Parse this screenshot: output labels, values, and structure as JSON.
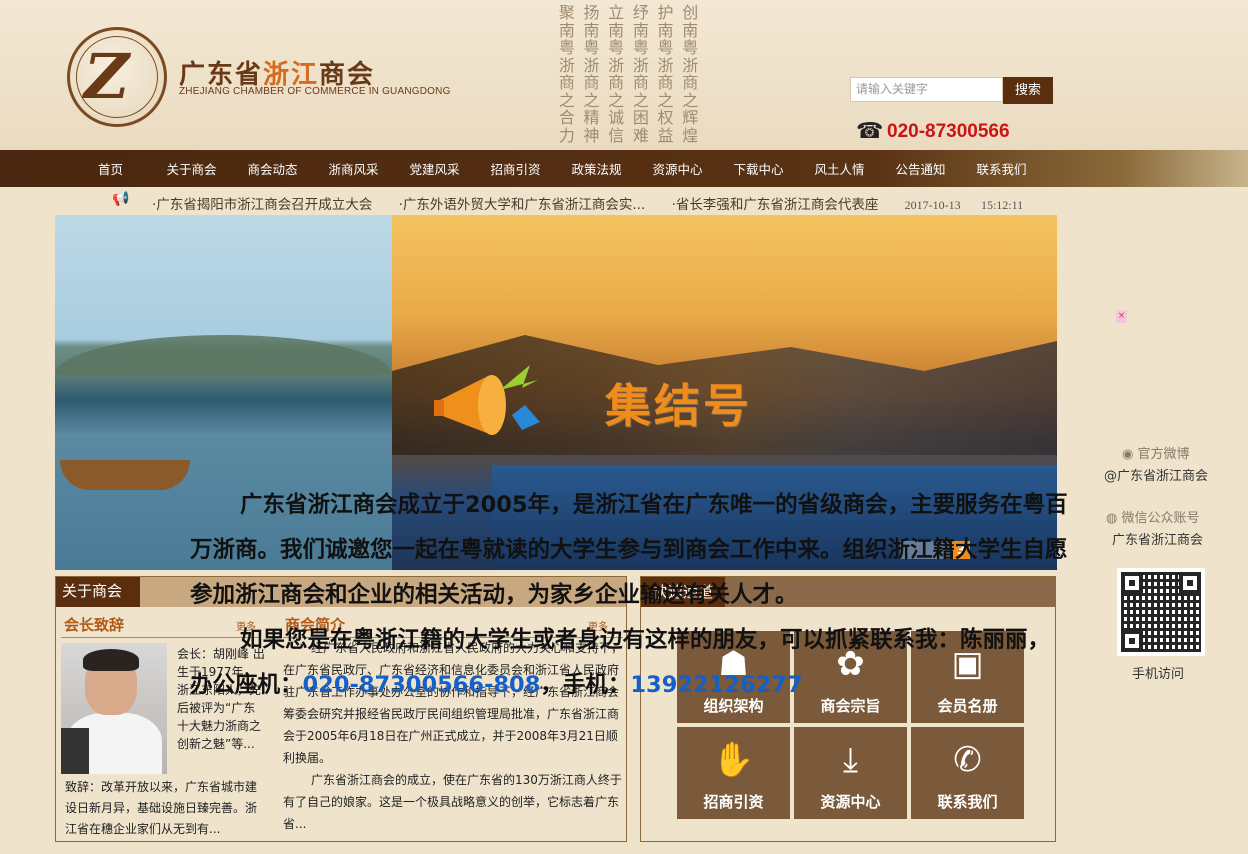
{
  "header": {
    "logo_title_a": "广东省",
    "logo_title_b": "浙江",
    "logo_title_c": "商会",
    "logo_sub": "ZHEJIANG CHAMBER OF COMMERCE IN GUANGDONG",
    "slogans": [
      "聚南粤浙商之合力",
      "扬南粤浙商之精神",
      "立南粤浙商之诚信",
      "纾南粤浙商之困难",
      "护南粤浙商之权益",
      "创南粤浙商之辉煌"
    ],
    "search_placeholder": "请输入关键字",
    "search_button": "搜索",
    "phone": "020-87300566"
  },
  "nav": [
    "首页",
    "关于商会",
    "商会动态",
    "浙商风采",
    "党建风采",
    "招商引资",
    "政策法规",
    "资源中心",
    "下载中心",
    "风土人情",
    "公告通知",
    "联系我们"
  ],
  "ticker": {
    "items": [
      "·广东省揭阳市浙江商会召开成立大会",
      "·广东外语外贸大学和广东省浙江商会实...",
      "·省长李强和广东省浙江商会代表座"
    ],
    "date": "2017-10-13",
    "time": "15:12:11"
  },
  "banner": {
    "headline": "集结号",
    "slide_number": "3"
  },
  "overlay": {
    "para1": "广东省浙江商会成立于2005年，是浙江省在广东唯一的省级商会，主要服务在粤百万浙商。我们诚邀您一起在粤就读的大学生参与到商会工作中来。组织浙江籍大学生自愿参加浙江商会和企业的相关活动，为家乡企业输送有关人才。",
    "para2_a": "如果您是在粤浙江籍的大学生或者身边有这样的朋友，可以抓紧联系我：陈丽丽，办公座机：",
    "para2_phone": "020-87300566-808",
    "para2_b": "，手机：",
    "para2_mobile": "13922126277"
  },
  "about": {
    "tab": "关于商会",
    "president_title": "会长致辞",
    "president_more": "更多",
    "president_info": "会长：胡刚峰 出生于1977年，浙江东阳人，先后被评为“广东十大魅力浙商之创新之魅”等...",
    "president_speech": "致辞：改革开放以来，广东省城市建设日新月异，基础设施日臻完善。浙江省在穗企业家们从无到有...",
    "intro_title": "商会简介",
    "intro_more": "更多",
    "intro_p1": "经广东省人民政府和浙江省人民政府的大力关心和支持下，在广东省民政厅、广东省经济和信息化委员会和浙江省人民政府驻广东省工作办事处办公室的协作和指导下，经广东省浙江商会筹委会研究并报经省民政厅民间组织管理局批准，广东省浙江商会于2005年6月18日在广州正式成立，并于2008年3月21日顺利换届。",
    "intro_p2": "广东省浙江商会的成立，使在广东省的130万浙江商人终于有了自己的娘家。这是一个极具战略意义的创举，它标志着广东省..."
  },
  "quick": {
    "tab": "快速通道",
    "items": [
      {
        "icon": "org-chart-icon",
        "glyph": "☗",
        "label": "组织架构"
      },
      {
        "icon": "tulip-icon",
        "glyph": "✿",
        "label": "商会宗旨"
      },
      {
        "icon": "contact-book-icon",
        "glyph": "▣",
        "label": "会员名册"
      },
      {
        "icon": "handshake-icon",
        "glyph": "✋",
        "label": "招商引资"
      },
      {
        "icon": "download-icon",
        "glyph": "⤓",
        "label": "资源中心"
      },
      {
        "icon": "phone-icon",
        "glyph": "✆",
        "label": "联系我们"
      }
    ]
  },
  "sidebar": {
    "weibo_label": "官方微博",
    "weibo_name": "@广东省浙江商会",
    "weixin_label": "微信公众账号",
    "weixin_name": "广东省浙江商会",
    "qr_label": "手机访问",
    "close": "×"
  }
}
